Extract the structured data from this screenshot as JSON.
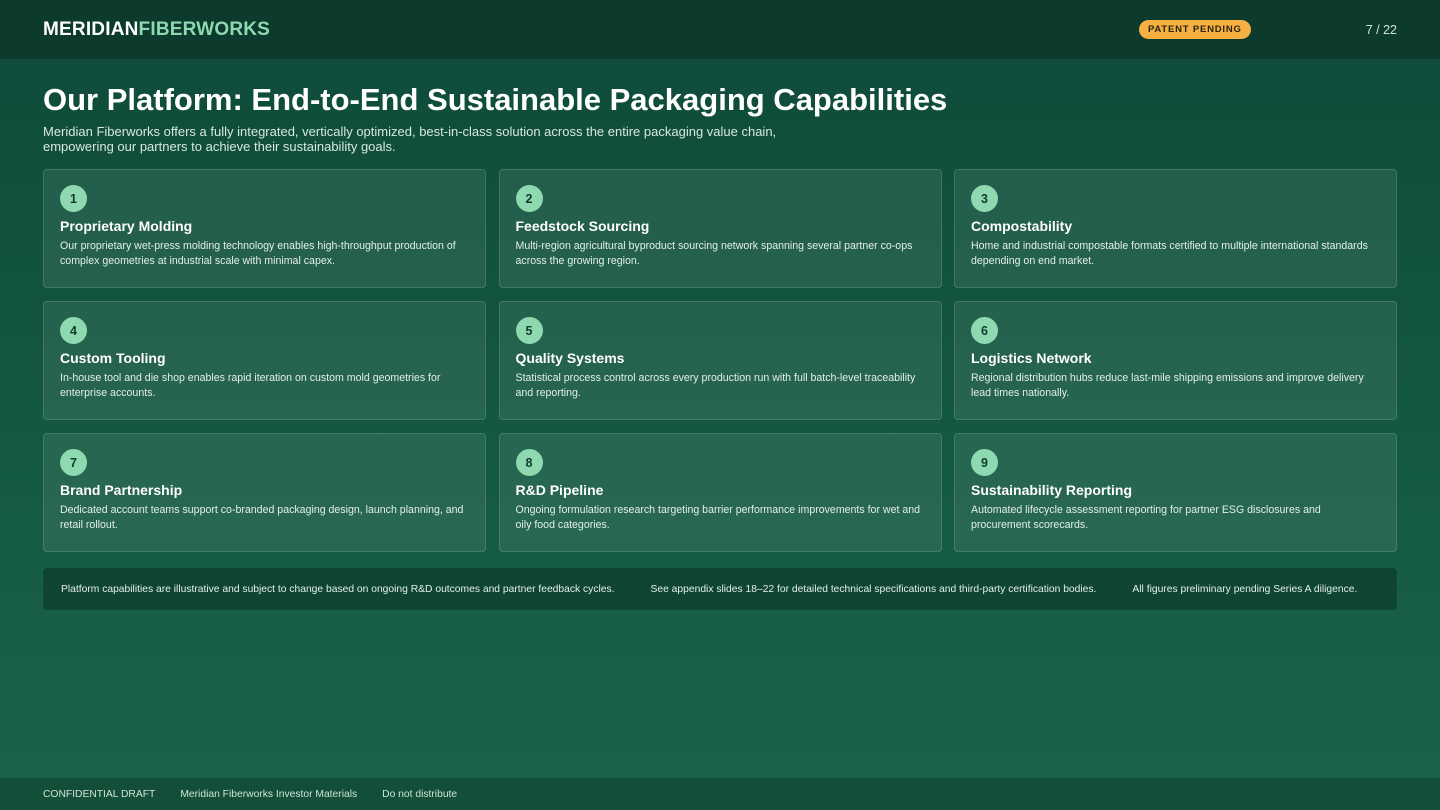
{
  "header": {
    "logo_part1": "MERIDIAN",
    "logo_part2": "FIBERWORKS",
    "badge": "PATENT PENDING",
    "page_indicator": "7 / 22"
  },
  "slide": {
    "title": "Our Platform: End-to-End Sustainable Packaging Capabilities",
    "subtitle": "Meridian Fiberworks offers a fully integrated, vertically optimized, best-in-class solution across the entire packaging value chain, empowering our partners to achieve their sustainability goals."
  },
  "cards": [
    {
      "num": "1",
      "title": "Proprietary Molding",
      "desc": "Our proprietary wet-press molding technology enables high-throughput production of complex geometries at industrial scale with minimal capex."
    },
    {
      "num": "2",
      "title": "Feedstock Sourcing",
      "desc": "Multi-region agricultural byproduct sourcing network spanning several partner co-ops across the growing region."
    },
    {
      "num": "3",
      "title": "Compostability",
      "desc": "Home and industrial compostable formats certified to multiple international standards depending on end market."
    },
    {
      "num": "4",
      "title": "Custom Tooling",
      "desc": "In-house tool and die shop enables rapid iteration on custom mold geometries for enterprise accounts."
    },
    {
      "num": "5",
      "title": "Quality Systems",
      "desc": "Statistical process control across every production run with full batch-level traceability and reporting."
    },
    {
      "num": "6",
      "title": "Logistics Network",
      "desc": "Regional distribution hubs reduce last-mile shipping emissions and improve delivery lead times nationally."
    },
    {
      "num": "7",
      "title": "Brand Partnership",
      "desc": "Dedicated account teams support co-branded packaging design, launch planning, and retail rollout."
    },
    {
      "num": "8",
      "title": "R&D Pipeline",
      "desc": "Ongoing formulation research targeting barrier performance improvements for wet and oily food categories."
    },
    {
      "num": "9",
      "title": "Sustainability Reporting",
      "desc": "Automated lifecycle assessment reporting for partner ESG disclosures and procurement scorecards."
    }
  ],
  "notes": [
    "Platform capabilities are illustrative and subject to change based on ongoing R&D outcomes and partner feedback cycles.",
    "See appendix slides 18–22 for detailed technical specifications and third-party certification bodies.",
    "All figures preliminary pending Series A diligence."
  ],
  "footer": [
    "CONFIDENTIAL DRAFT",
    "Meridian Fiberworks Investor Materials",
    "Do not distribute"
  ],
  "colors": {
    "accent": "#8fd9b0",
    "badge": "#f5b041",
    "background": "#13553f"
  }
}
